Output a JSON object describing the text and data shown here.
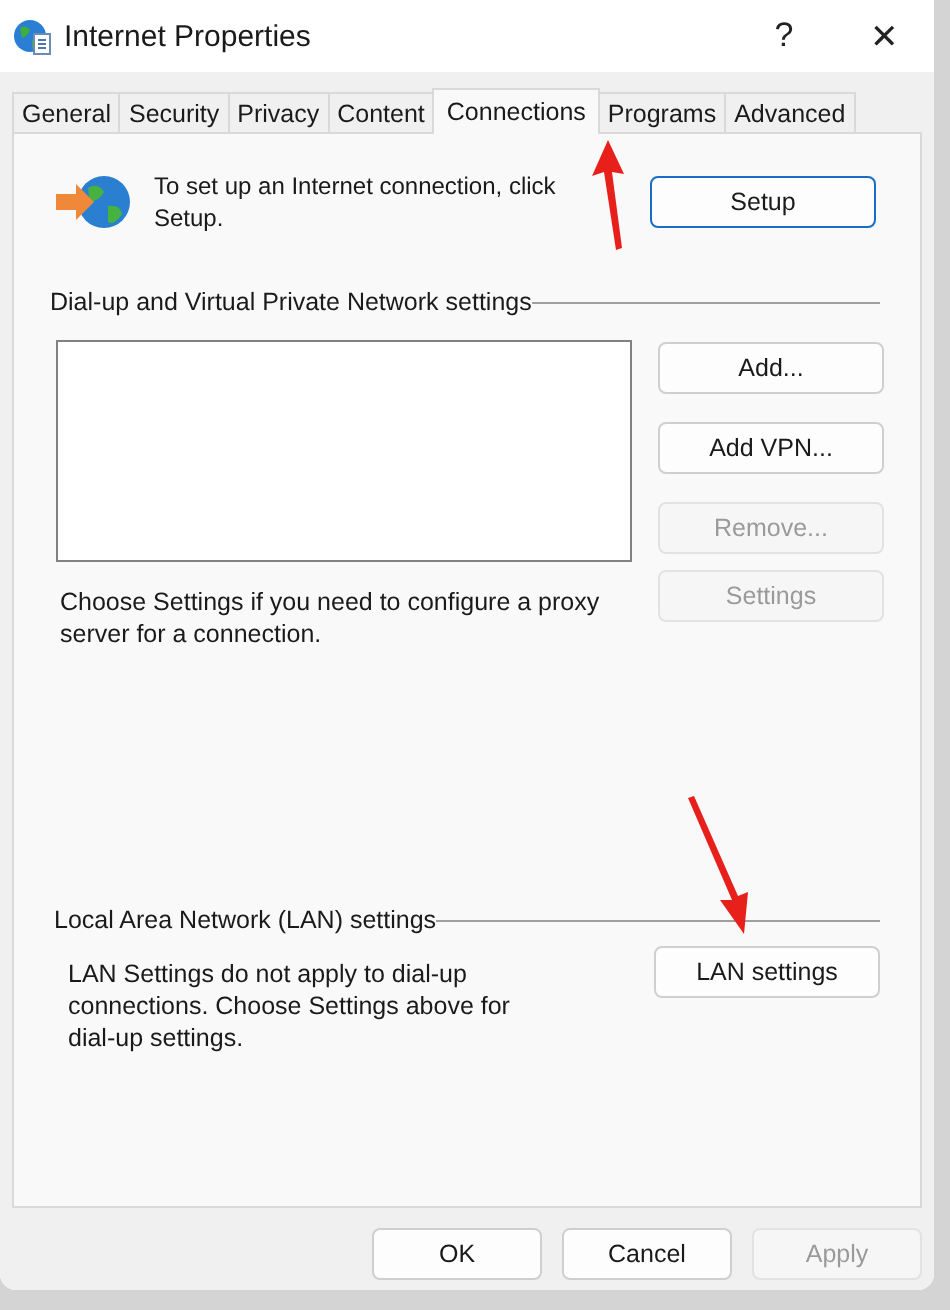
{
  "window": {
    "title": "Internet Properties",
    "help": "?",
    "close": "✕"
  },
  "tabs": [
    {
      "label": "General",
      "selected": false
    },
    {
      "label": "Security",
      "selected": false
    },
    {
      "label": "Privacy",
      "selected": false
    },
    {
      "label": "Content",
      "selected": false
    },
    {
      "label": "Connections",
      "selected": true
    },
    {
      "label": "Programs",
      "selected": false
    },
    {
      "label": "Advanced",
      "selected": false
    }
  ],
  "setup": {
    "text": "To set up an Internet connection, click Setup.",
    "button": {
      "label": "Setup",
      "disabled": false,
      "focused": true
    }
  },
  "dialup": {
    "heading": "Dial-up and Virtual Private Network settings",
    "buttons": [
      {
        "label": "Add...",
        "disabled": false,
        "focused": false
      },
      {
        "label": "Add VPN...",
        "disabled": false,
        "focused": false
      },
      {
        "label": "Remove...",
        "disabled": true,
        "focused": false
      }
    ],
    "proxy_text": "Choose Settings if you need to configure a proxy server for a connection.",
    "settings_button": {
      "label": "Settings",
      "disabled": true,
      "focused": false
    }
  },
  "lan": {
    "heading": "Local Area Network (LAN) settings",
    "text": "LAN Settings do not apply to dial-up connections. Choose Settings above for dial-up settings.",
    "button": {
      "label": "LAN settings",
      "disabled": false,
      "focused": false
    }
  },
  "footer_buttons": [
    {
      "label": "OK",
      "disabled": false,
      "focused": false
    },
    {
      "label": "Cancel",
      "disabled": false,
      "focused": false
    },
    {
      "label": "Apply",
      "disabled": true,
      "focused": false
    }
  ]
}
